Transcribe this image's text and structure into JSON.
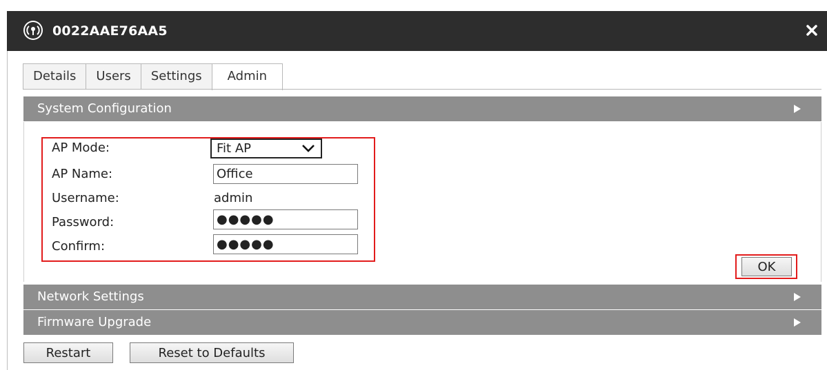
{
  "window": {
    "title": "0022AAE76AA5",
    "logo_icon": "ap-logo-icon",
    "close_icon": "close-icon"
  },
  "tabs": [
    {
      "label": "Details",
      "active": false
    },
    {
      "label": "Users",
      "active": false
    },
    {
      "label": "Settings",
      "active": false
    },
    {
      "label": "Admin",
      "active": true
    }
  ],
  "sections": {
    "system": {
      "title": "System Configuration",
      "expanded": true
    },
    "network": {
      "title": "Network Settings",
      "expanded": false
    },
    "firmware": {
      "title": "Firmware Upgrade",
      "expanded": false
    }
  },
  "form": {
    "ap_mode": {
      "label": "AP Mode:",
      "value": "Fit AP"
    },
    "ap_name": {
      "label": "AP Name:",
      "value": "Office"
    },
    "username": {
      "label": "Username:",
      "value": "admin"
    },
    "password": {
      "label": "Password:",
      "value": "●●●●●"
    },
    "confirm": {
      "label": "Confirm:",
      "value": "●●●●●"
    }
  },
  "buttons": {
    "ok": "OK",
    "restart": "Restart",
    "reset": "Reset to Defaults"
  },
  "colors": {
    "titlebar": "#2d2d2d",
    "section_header": "#8e8e8e",
    "highlight": "#e21b1b"
  }
}
